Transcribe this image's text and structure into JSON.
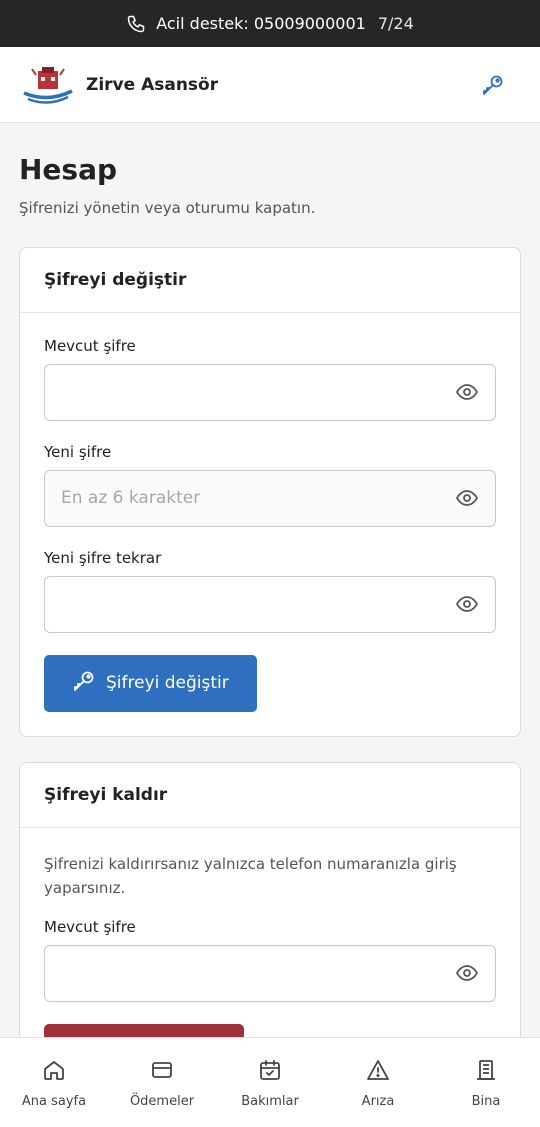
{
  "topbar": {
    "label": "Acil destek: 05009000001",
    "hours": "7/24",
    "icon": "phone-icon"
  },
  "header": {
    "brand": "Zirve Asansör",
    "key_icon": "key-icon"
  },
  "page": {
    "title": "Hesap",
    "subtitle": "Şifrenizi yönetin veya oturumu kapatın."
  },
  "change_password": {
    "title": "Şifreyi değiştir",
    "current_label": "Mevcut şifre",
    "current_value": "",
    "new_label": "Yeni şifre",
    "new_placeholder": "En az 6 karakter",
    "repeat_label": "Yeni şifre tekrar",
    "repeat_value": "",
    "button_label": "Şifreyi değiştir"
  },
  "remove_password": {
    "title": "Şifreyi kaldır",
    "description": "Şifrenizi kaldırırsanız yalnızca telefon numaranızla giriş yaparsınız.",
    "current_label": "Mevcut şifre",
    "current_value": ""
  },
  "bottom_nav": [
    {
      "label": "Ana sayfa",
      "icon": "home-icon"
    },
    {
      "label": "Ödemeler",
      "icon": "card-icon"
    },
    {
      "label": "Bakımlar",
      "icon": "calendar-check-icon"
    },
    {
      "label": "Arıza",
      "icon": "warning-icon"
    },
    {
      "label": "Bina",
      "icon": "building-icon"
    }
  ],
  "colors": {
    "primary": "#2f6fc0",
    "danger": "#a0303a",
    "topbar": "#262626"
  }
}
